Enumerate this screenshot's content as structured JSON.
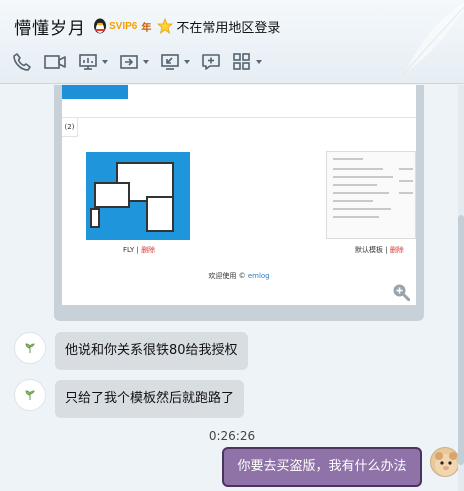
{
  "header": {
    "title": "懵懂岁月",
    "vip_label": "SVIP6",
    "year_label": "年",
    "status_text": "不在常用地区登录"
  },
  "toolbar": {
    "icons": [
      "phone-icon",
      "video-icon",
      "screen-share-icon",
      "remote-assist-icon",
      "screenshot-icon",
      "add-chat-icon",
      "apps-icon"
    ]
  },
  "shared_image": {
    "top_link": "设置",
    "tab_label": "(2)",
    "theme1_name": "FLY",
    "theme2_name": "默认模板",
    "delete_label": "删除",
    "separator": " | ",
    "welcome_text": "欢迎使用 © ",
    "welcome_link": "emlog"
  },
  "messages": [
    {
      "sender": "other",
      "text": "他说和你关系很铁80给我授权"
    },
    {
      "sender": "other",
      "text": "只给了我个模板然后就跑路了"
    }
  ],
  "timestamp": "0:26:26",
  "my_message": {
    "text": "你要去买盗版，我有什么办法"
  }
}
